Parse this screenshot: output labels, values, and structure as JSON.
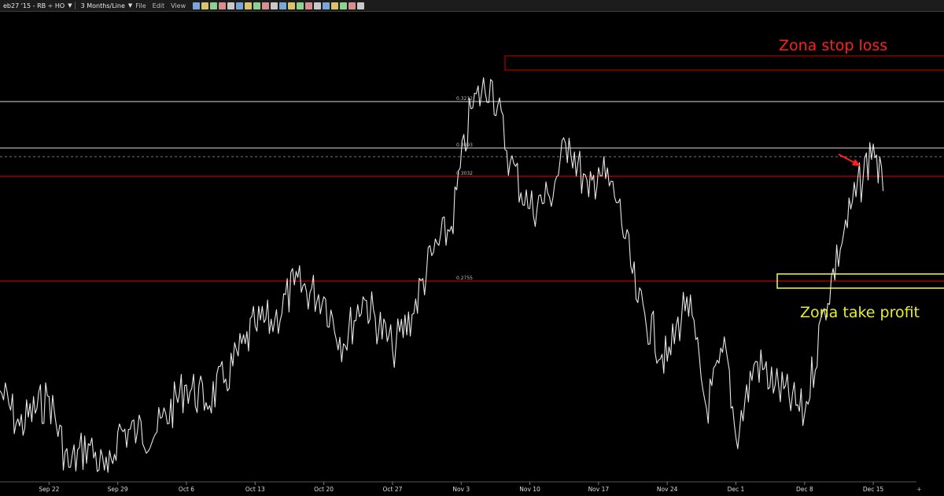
{
  "toolbar": {
    "symbol": "eb27 '15 - RB ÷ HO",
    "timeframe": "3 Months/Line",
    "menu_file": "File",
    "menu_edit": "Edit",
    "menu_view": "View",
    "icons": [
      "square-icon",
      "square-icon",
      "chart-icon",
      "chart-icon",
      "chart-icon",
      "cursor-icon",
      "zoom-in-icon",
      "zoom-out-icon",
      "hand-icon",
      "undo-icon",
      "redo-icon",
      "reset-icon",
      "settings-icon",
      "print-icon",
      "draw-icon",
      "line-icon",
      "channel-icon",
      "fib-icon",
      "marker-icon",
      "tools-icon"
    ]
  },
  "colors": {
    "background": "#000000",
    "price_line": "#e6e6e6",
    "support_line": "#c00000",
    "stop_zone": "#a00000",
    "take_profit_zone": "#e8ef2a",
    "annotation_stop": "#ff2020",
    "annotation_tp": "#e8ef2a"
  },
  "chart_data": {
    "type": "line",
    "x_tick_labels": [
      "Sep 22",
      "Sep 29",
      "Oct 6",
      "Oct 13",
      "Oct 20",
      "Oct 27",
      "Nov 3",
      "Nov 10",
      "Nov 17",
      "Nov 24",
      "Dec 1",
      "Dec 8",
      "Dec 15"
    ],
    "x_range": [
      "2014-09-17",
      "2014-12-19"
    ],
    "ylim": [
      0.2615,
      0.3415
    ],
    "series": [
      {
        "x": [
          "2014-09-17",
          "2014-09-19",
          "2014-09-22",
          "2014-09-24",
          "2014-09-26",
          "2014-09-28",
          "2014-09-29",
          "2014-10-01",
          "2014-10-03",
          "2014-10-06",
          "2014-10-08",
          "2014-10-10",
          "2014-10-12",
          "2014-10-13",
          "2014-10-15",
          "2014-10-17",
          "2014-10-20",
          "2014-10-22",
          "2014-10-24",
          "2014-10-27",
          "2014-10-29",
          "2014-10-31",
          "2014-11-02",
          "2014-11-04",
          "2014-11-06",
          "2014-11-08",
          "2014-11-10",
          "2014-11-12",
          "2014-11-14",
          "2014-11-16",
          "2014-11-17",
          "2014-11-19",
          "2014-11-21",
          "2014-11-24",
          "2014-11-26",
          "2014-11-28",
          "2014-11-30",
          "2014-12-01",
          "2014-12-03",
          "2014-12-05",
          "2014-12-08",
          "2014-12-10",
          "2014-12-12",
          "2014-12-15",
          "2014-12-16"
        ],
        "values": [
          0.277,
          0.271,
          0.276,
          0.264,
          0.268,
          0.262,
          0.27,
          0.27,
          0.27,
          0.278,
          0.275,
          0.279,
          0.285,
          0.288,
          0.289,
          0.295,
          0.293,
          0.285,
          0.293,
          0.284,
          0.29,
          0.3,
          0.305,
          0.325,
          0.33,
          0.316,
          0.308,
          0.31,
          0.32,
          0.31,
          0.315,
          0.309,
          0.292,
          0.282,
          0.293,
          0.274,
          0.284,
          0.269,
          0.282,
          0.278,
          0.273,
          0.291,
          0.304,
          0.319,
          0.311
        ]
      }
    ],
    "levels": [
      "0.3212",
      "0.3093",
      "0.3032",
      "0.2755"
    ],
    "annotations": {
      "stop_loss": "Zona stop loss",
      "take_profit": "Zona take profit"
    },
    "grid": false
  }
}
